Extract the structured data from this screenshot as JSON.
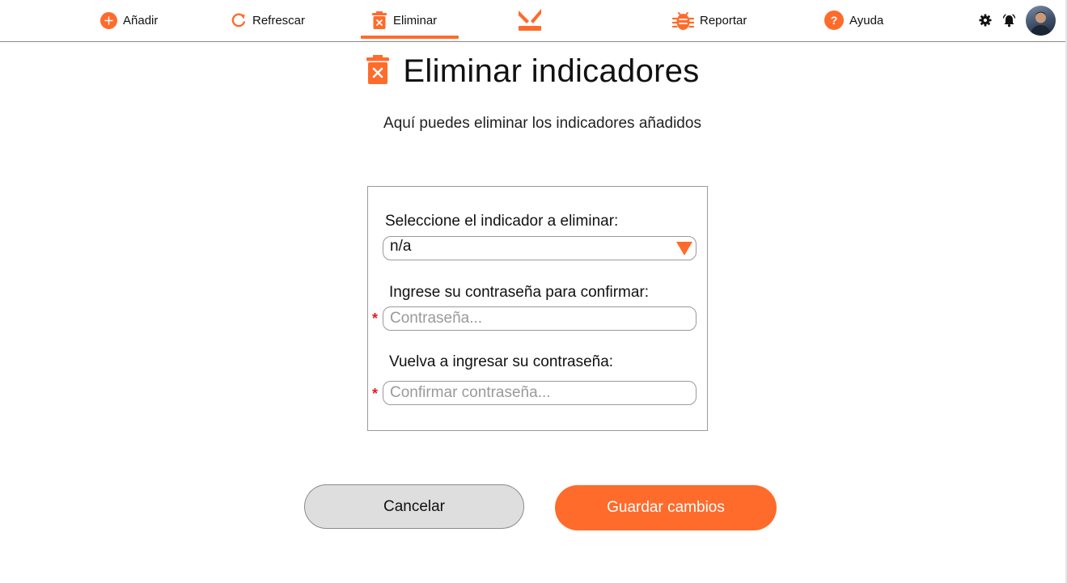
{
  "nav": {
    "add_label": "Añadir",
    "refresh_label": "Refrescar",
    "delete_label": "Eliminar",
    "report_label": "Reportar",
    "help_label": "Ayuda",
    "active_tab": "Eliminar",
    "icons": {
      "add": "plus-circle-icon",
      "refresh": "refresh-icon",
      "delete": "trash-icon",
      "logo": "logo-icon",
      "report": "bug-icon",
      "help": "question-circle-icon",
      "settings": "gear-icon",
      "notifications": "bell-icon"
    }
  },
  "header": {
    "title": "Eliminar indicadores",
    "subtitle": "Aquí puedes eliminar los indicadores añadidos"
  },
  "form": {
    "indicator_label": "Seleccione el indicador a eliminar:",
    "indicator_selected": "n/a",
    "password_label": "Ingrese su contraseña para confirmar:",
    "password_placeholder": "Contraseña...",
    "confirm_label": "Vuelva a ingresar su contraseña:",
    "confirm_placeholder": "Confirmar contraseña...",
    "required_mark": "*"
  },
  "actions": {
    "cancel_label": "Cancelar",
    "save_label": "Guardar cambios"
  },
  "colors": {
    "accent": "#ff6b2b",
    "cancel_bg": "#dedede",
    "required": "#e02020",
    "border": "#9a9a9a"
  }
}
